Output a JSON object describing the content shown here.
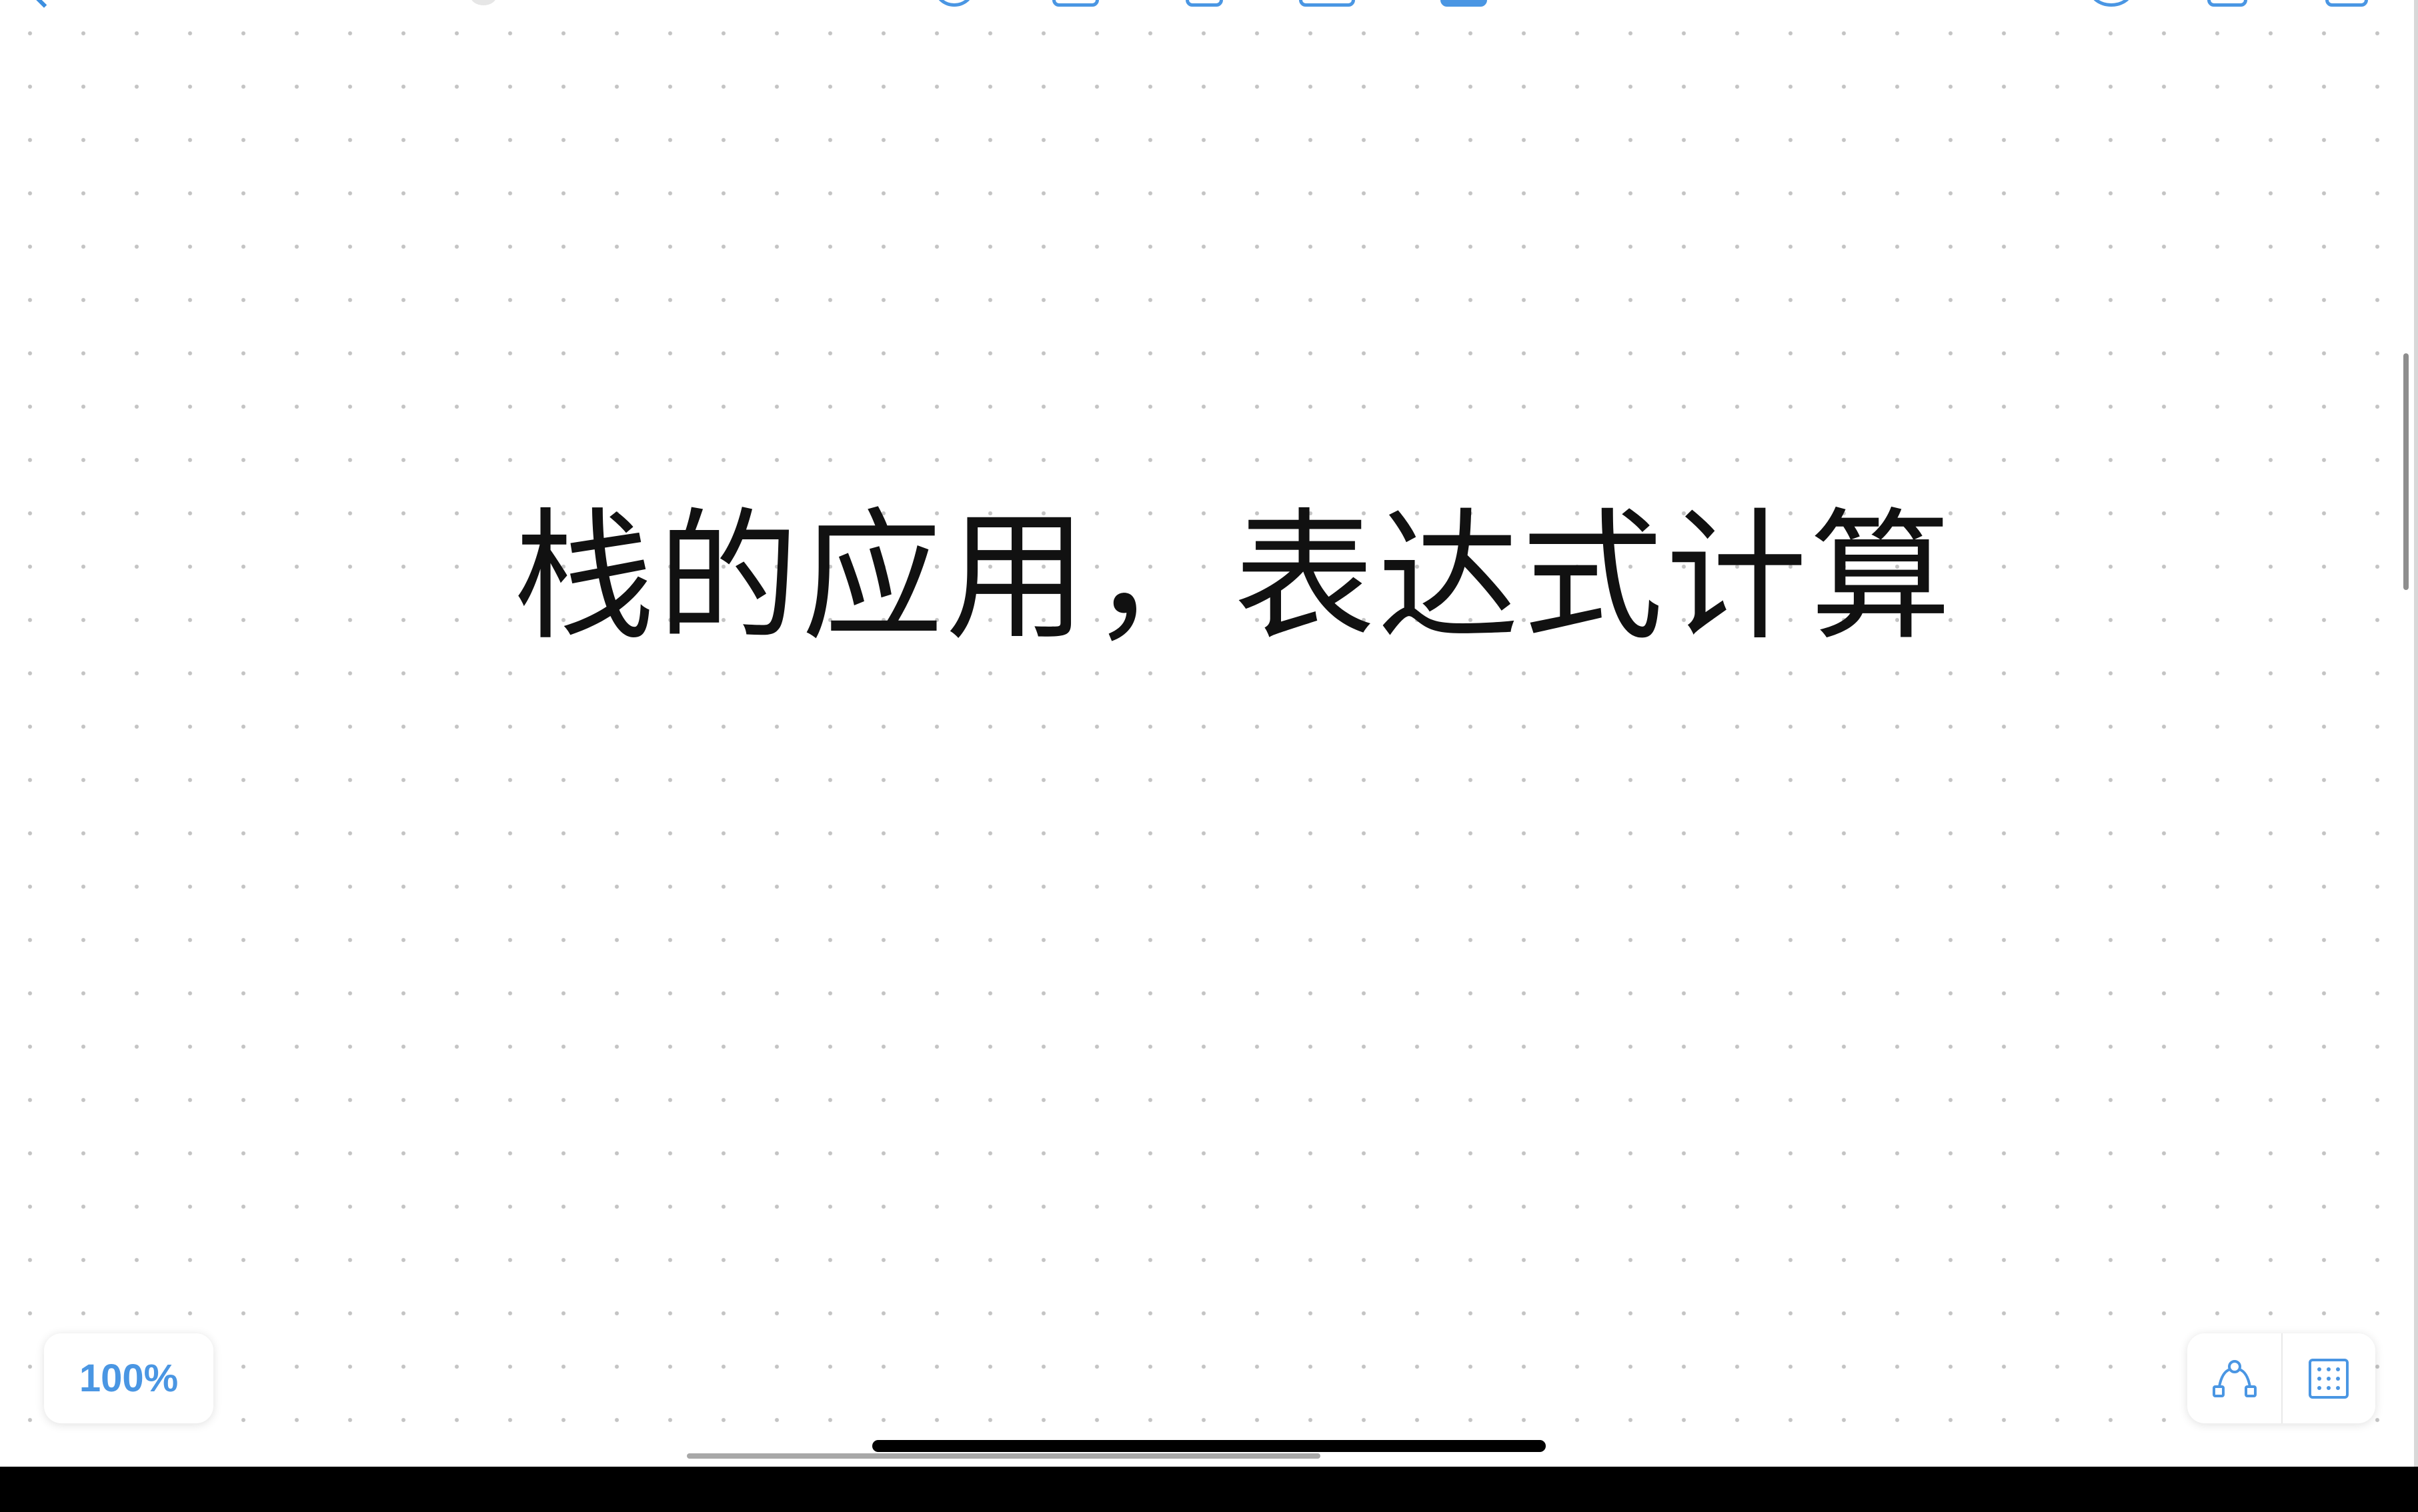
{
  "canvas": {
    "heading": "栈的应用，表达式计算"
  },
  "zoom": {
    "label": "100%"
  },
  "tools": {
    "connect_icon": "node-connection-icon",
    "grid_icon": "dot-grid-icon"
  },
  "colors": {
    "accent": "#4a96e3",
    "canvas_background": "#ffffff",
    "grid_dot": "#c4c4c4",
    "text": "#111111"
  }
}
